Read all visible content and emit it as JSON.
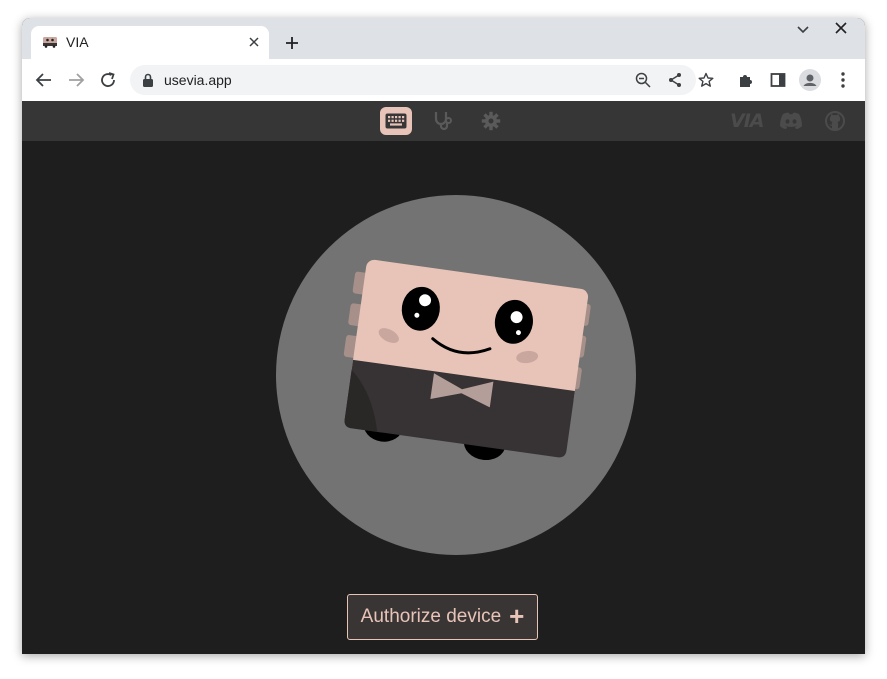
{
  "browser": {
    "tab": {
      "title": "VIA",
      "favicon": "via-robot-favicon"
    },
    "new_tab_icon": "plus-icon",
    "url": "usevia.app",
    "toolbar_icons": [
      "back-arrow-icon",
      "forward-arrow-icon",
      "reload-icon",
      "lock-icon",
      "zoom-out-icon",
      "share-icon",
      "star-icon",
      "extensions-icon",
      "side-panel-icon",
      "profile-icon",
      "menu-dots-icon"
    ]
  },
  "app_header": {
    "nav": [
      {
        "name": "configure",
        "icon": "keyboard-icon",
        "active": true
      },
      {
        "name": "test",
        "icon": "stethoscope-icon",
        "active": false
      },
      {
        "name": "settings",
        "icon": "gear-icon",
        "active": false
      }
    ],
    "right": {
      "logo": "VIA",
      "discord_icon": "discord-icon",
      "github_icon": "github-icon"
    }
  },
  "main": {
    "mascot": "via-keyboard-mascot",
    "authorize_label": "Authorize device",
    "authorize_icon": "+"
  },
  "colors": {
    "accent": "#e8c4b8",
    "background": "#1e1e1e",
    "header": "#363636",
    "circle": "#737373"
  }
}
